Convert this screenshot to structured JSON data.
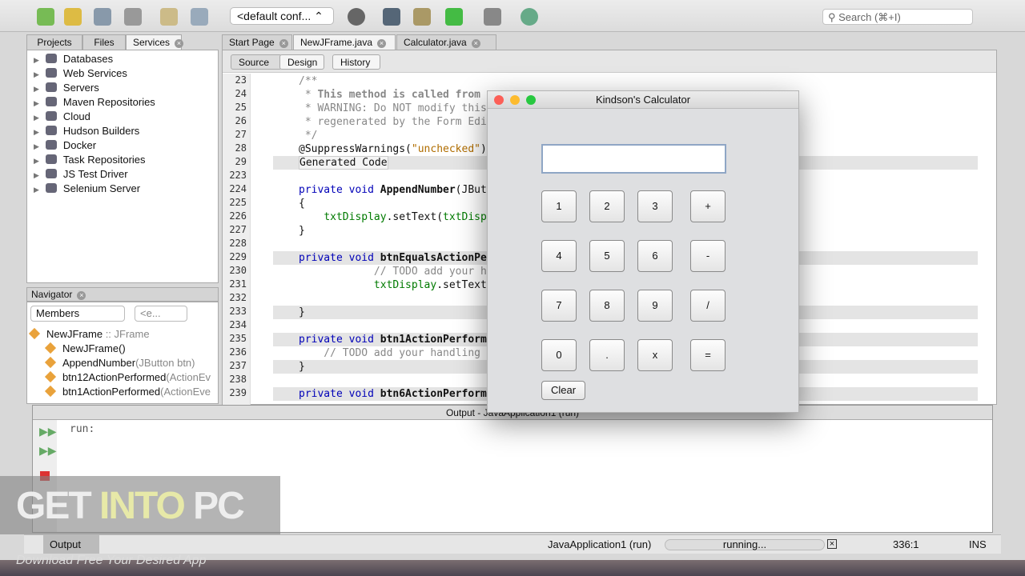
{
  "toolbar": {
    "config": "<default conf...",
    "search_placeholder": "Search (⌘+I)",
    "icons": [
      "new-file-icon",
      "new-project-icon",
      "open-project-icon",
      "save-all-icon",
      "undo-icon",
      "redo-icon",
      "globe-icon",
      "build-icon",
      "clean-build-icon",
      "run-icon",
      "debug-icon",
      "profile-icon"
    ]
  },
  "left_tabs": [
    "Projects",
    "Files",
    "Services"
  ],
  "services": [
    "Databases",
    "Web Services",
    "Servers",
    "Maven Repositories",
    "Cloud",
    "Hudson Builders",
    "Docker",
    "Task Repositories",
    "JS Test Driver",
    "Selenium Server"
  ],
  "navigator": {
    "title": "Navigator",
    "filter": "Members",
    "filter2": "<e...",
    "items": [
      {
        "name": "NewJFrame",
        "type": " :: JFrame"
      },
      {
        "name": "NewJFrame()",
        "type": ""
      },
      {
        "name": "AppendNumber",
        "type": "(JButton btn)"
      },
      {
        "name": "btn12ActionPerformed",
        "type": "(ActionEv"
      },
      {
        "name": "btn1ActionPerformed",
        "type": "(ActionEve"
      }
    ]
  },
  "editor_tabs": [
    "Start Page",
    "NewJFrame.java",
    "Calculator.java"
  ],
  "editor_buttons": [
    "Source",
    "Design",
    "History"
  ],
  "code": [
    {
      "n": "23",
      "t": [
        [
          "cm",
          "/**"
        ]
      ]
    },
    {
      "n": "24",
      "t": [
        [
          "cm",
          " * "
        ],
        [
          "cm fn",
          "This method is called from"
        ]
      ]
    },
    {
      "n": "25",
      "t": [
        [
          "cm",
          " * WARNING: Do NOT modify this"
        ]
      ]
    },
    {
      "n": "26",
      "t": [
        [
          "cm",
          " * regenerated by the Form Edi"
        ]
      ]
    },
    {
      "n": "27",
      "t": [
        [
          "cm",
          " */"
        ]
      ]
    },
    {
      "n": "28",
      "t": [
        [
          "",
          "@SuppressWarnings("
        ],
        [
          "str",
          "\"unchecked\""
        ],
        [
          "",
          ")"
        ]
      ]
    },
    {
      "n": "29",
      "h": 1,
      "t": [
        [
          "gc",
          "Generated Code"
        ]
      ]
    },
    {
      "n": "223",
      "t": []
    },
    {
      "n": "224",
      "t": [
        [
          "kw",
          "private void "
        ],
        [
          "fn",
          "AppendNumber"
        ],
        [
          "",
          "(JBut"
        ]
      ]
    },
    {
      "n": "225",
      "t": [
        [
          "",
          "{"
        ]
      ]
    },
    {
      "n": "226",
      "t": [
        [
          "",
          "    "
        ],
        [
          "fld",
          "txtDisplay"
        ],
        [
          "",
          ".setText("
        ],
        [
          "fld",
          "txtDisp"
        ]
      ]
    },
    {
      "n": "227",
      "t": [
        [
          "",
          "}"
        ]
      ]
    },
    {
      "n": "228",
      "t": []
    },
    {
      "n": "229",
      "h": 1,
      "t": [
        [
          "kw",
          "private void "
        ],
        [
          "fn",
          "btnEqualsActionPe"
        ]
      ]
    },
    {
      "n": "230",
      "t": [
        [
          "cm",
          "            // TODO add your h"
        ]
      ]
    },
    {
      "n": "231",
      "t": [
        [
          "",
          "            "
        ],
        [
          "fld",
          "txtDisplay"
        ],
        [
          "",
          ".setText"
        ]
      ]
    },
    {
      "n": "232",
      "t": []
    },
    {
      "n": "233",
      "h": 1,
      "t": [
        [
          "",
          "}"
        ]
      ]
    },
    {
      "n": "234",
      "t": []
    },
    {
      "n": "235",
      "h": 1,
      "t": [
        [
          "kw",
          "private void "
        ],
        [
          "fn",
          "btn1ActionPerform"
        ]
      ]
    },
    {
      "n": "236",
      "t": [
        [
          "cm",
          "    // TODO add your handling"
        ]
      ]
    },
    {
      "n": "237",
      "h": 1,
      "t": [
        [
          "",
          "}"
        ]
      ]
    },
    {
      "n": "238",
      "t": []
    },
    {
      "n": "239",
      "h": 1,
      "t": [
        [
          "kw",
          "private void "
        ],
        [
          "fn",
          "btn6ActionPerform"
        ]
      ]
    }
  ],
  "calculator": {
    "title": "Kindson's Calculator",
    "display": "",
    "buttons": [
      [
        "1",
        "2",
        "3",
        "+"
      ],
      [
        "4",
        "5",
        "6",
        "-"
      ],
      [
        "7",
        "8",
        "9",
        "/"
      ],
      [
        "0",
        ".",
        "x",
        "="
      ]
    ],
    "clear": "Clear"
  },
  "output": {
    "title": "Output - JavaApplication1 (run)",
    "text": "run:"
  },
  "status": {
    "tab": "Output",
    "process": "JavaApplication1 (run)",
    "state": "running...",
    "position": "336:1",
    "mode": "INS"
  },
  "watermark": {
    "text1": "GET ",
    "text2": "INTO",
    "text3": " PC",
    "tagline": "Download Free Your Desired App"
  }
}
